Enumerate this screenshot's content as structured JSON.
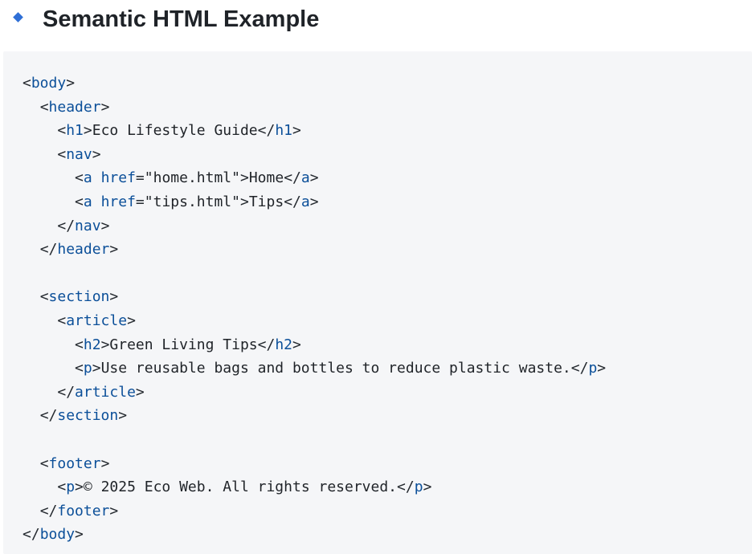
{
  "heading": {
    "icon": "diamond-icon",
    "title": "Semantic HTML Example"
  },
  "colors": {
    "accent": "#2f6fd6",
    "tag": "#0b4f99",
    "text": "#1f2328",
    "code_background": "#f5f6f8"
  },
  "code": {
    "language": "html",
    "lines": [
      "<body>",
      "  <header>",
      "    <h1>Eco Lifestyle Guide</h1>",
      "    <nav>",
      "      <a href=\"home.html\">Home</a>",
      "      <a href=\"tips.html\">Tips</a>",
      "    </nav>",
      "  </header>",
      "",
      "  <section>",
      "    <article>",
      "      <h2>Green Living Tips</h2>",
      "      <p>Use reusable bags and bottles to reduce plastic waste.</p>",
      "    </article>",
      "  </section>",
      "",
      "  <footer>",
      "    <p>© 2025 Eco Web. All rights reserved.</p>",
      "  </footer>",
      "</body>"
    ]
  }
}
